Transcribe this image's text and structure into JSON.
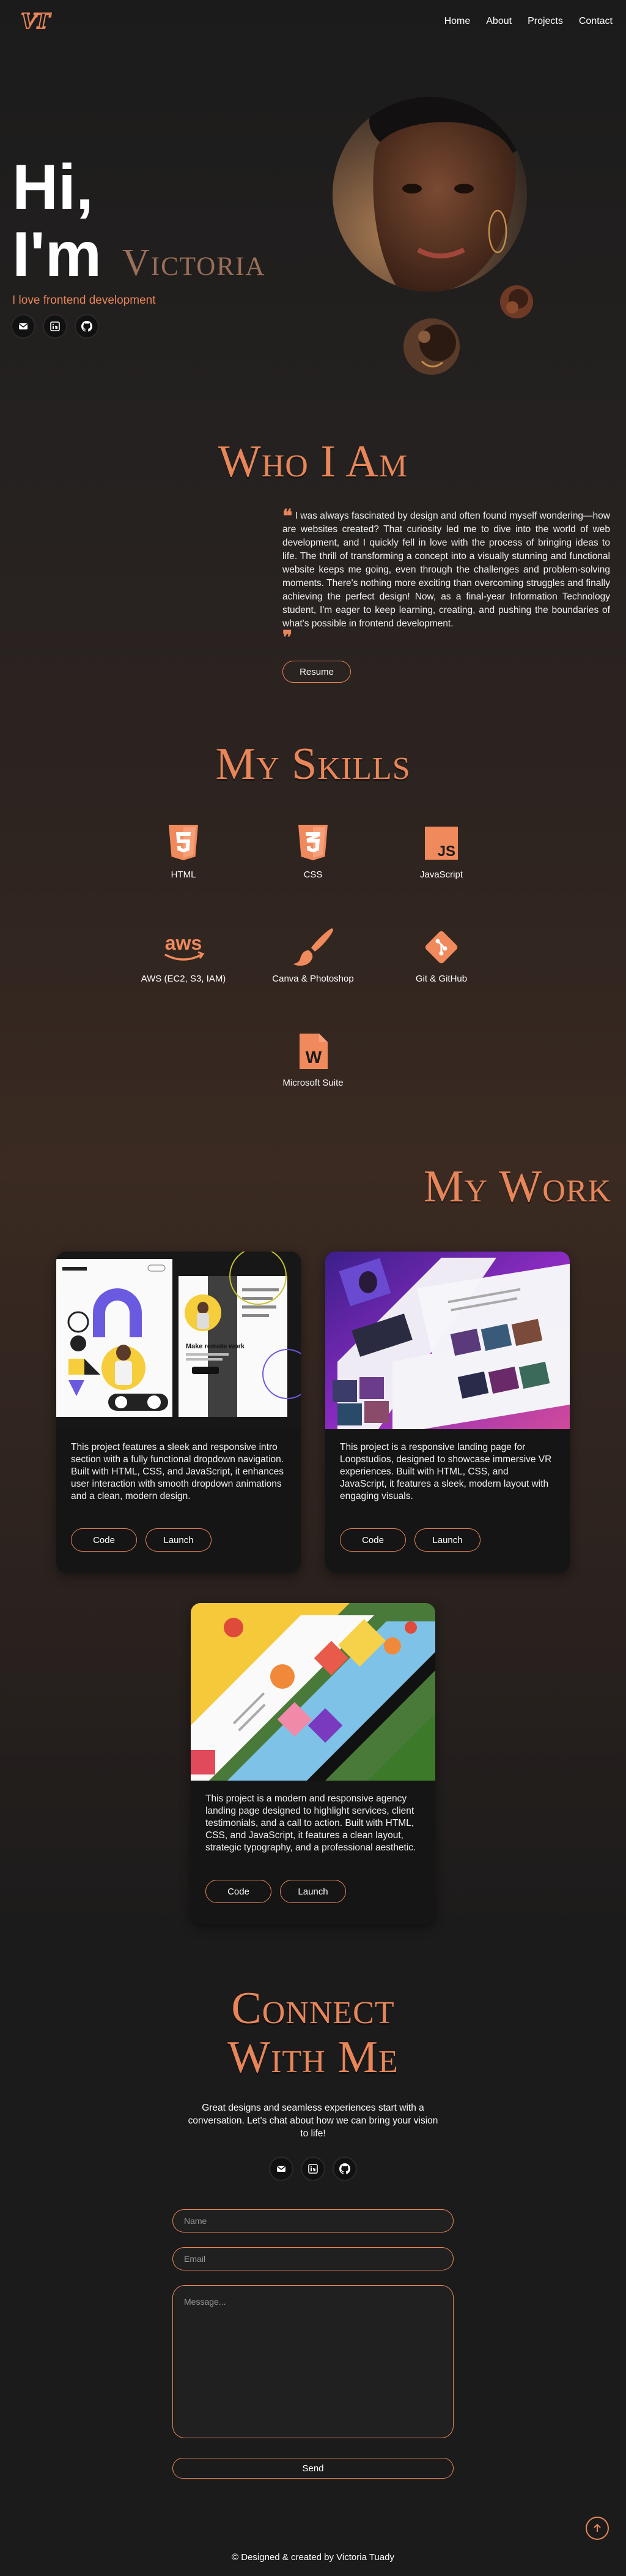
{
  "nav": {
    "logo": "VT",
    "links": [
      "Home",
      "About",
      "Projects",
      "Contact"
    ]
  },
  "hero": {
    "greeting": "Hi,",
    "intro": "I'm",
    "name": "Victoria",
    "tagline": "I love frontend development",
    "socials": [
      "email-icon",
      "linkedin-icon",
      "github-icon"
    ]
  },
  "about": {
    "title": "Who I Am",
    "text": "I was always fascinated by design and often found myself wondering—how are websites created? That curiosity led me to dive into the world of web development, and I quickly fell in love with the process of bringing ideas to life. The thrill of transforming a concept into a visually stunning and functional website keeps me going, even through the challenges and problem-solving moments. There's nothing more exciting than overcoming struggles and finally achieving the perfect design! Now, as a final-year Information Technology student, I'm eager to keep learning, creating, and pushing the boundaries of what's possible in frontend development.",
    "resume_label": "Resume"
  },
  "skills": {
    "title": "My Skills",
    "items": [
      {
        "label": "HTML",
        "icon": "html5-icon"
      },
      {
        "label": "CSS",
        "icon": "css3-icon"
      },
      {
        "label": "JavaScript",
        "icon": "javascript-icon"
      },
      {
        "label": "AWS (EC2, S3, IAM)",
        "icon": "aws-icon"
      },
      {
        "label": "Canva & Photoshop",
        "icon": "paintbrush-icon"
      },
      {
        "label": "Git & GitHub",
        "icon": "git-icon"
      },
      {
        "label": "Microsoft Suite",
        "icon": "word-icon"
      }
    ]
  },
  "work": {
    "title": "My Work",
    "code_label": "Code",
    "launch_label": "Launch",
    "projects": [
      {
        "description": "This project features a sleek and responsive intro section with a fully functional dropdown navigation. Built with HTML, CSS, and JavaScript, it enhances user interaction with smooth dropdown animations and a clean, modern design.",
        "preview_heading": "Make remote work"
      },
      {
        "description": "This project is a responsive landing page for Loopstudios, designed to showcase immersive VR experiences. Built with HTML, CSS, and JavaScript, it features a sleek, modern layout with engaging visuals."
      },
      {
        "description": "This project is a modern and responsive agency landing page designed to highlight services, client testimonials, and a call to action. Built with HTML, CSS, and JavaScript, it features a clean layout, strategic typography, and a professional aesthetic."
      }
    ]
  },
  "contact": {
    "title_line1": "Connect",
    "title_line2": "With Me",
    "subtitle": "Great designs and seamless experiences start with a conversation. Let's chat about how we can bring your vision to life!",
    "name_placeholder": "Name",
    "email_placeholder": "Email",
    "message_placeholder": "Message...",
    "send_label": "Send"
  },
  "footer": {
    "text": "© Designed & created by Victoria Tuady"
  },
  "colors": {
    "accent": "#e8865a",
    "background": "#1b1b1b",
    "card": "#151515"
  }
}
